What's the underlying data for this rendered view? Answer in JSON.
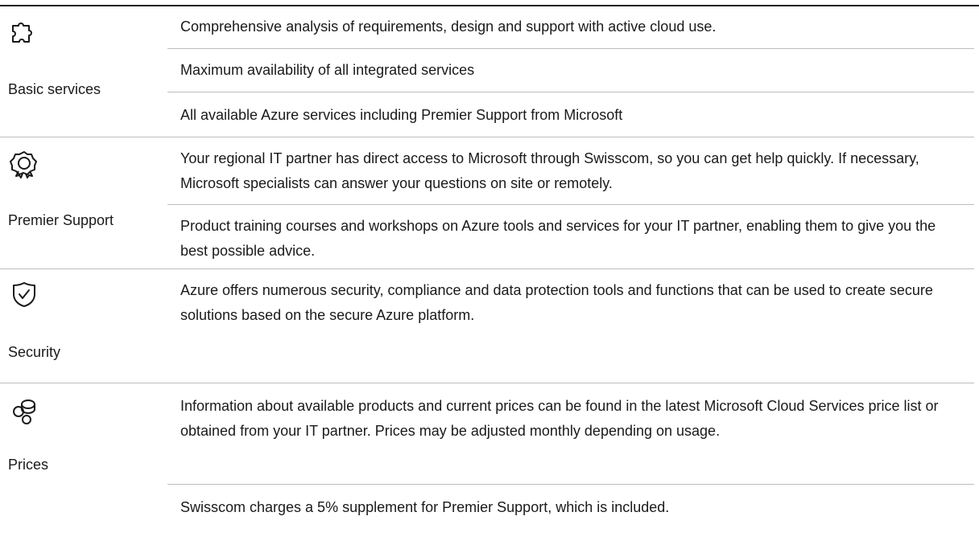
{
  "sections": [
    {
      "label": "Basic services",
      "icon": "puzzle-icon",
      "items": [
        "Comprehensive analysis of requirements, design and support with active cloud use.",
        "Maximum availability of all integrated services",
        "All available Azure services including Premier Support from Microsoft"
      ]
    },
    {
      "label": "Premier Support",
      "icon": "award-badge-icon",
      "items": [
        "Your regional IT partner has direct access to Microsoft through Swisscom, so you can get help quickly. If necessary, Microsoft specialists can answer your questions on site or remotely.",
        "Product training courses and workshops on Azure tools and services for your IT partner, enabling them to give you the best possible advice."
      ]
    },
    {
      "label": "Security",
      "icon": "shield-check-icon",
      "items": [
        "Azure offers numerous security, compliance and data protection tools and functions that can be used to create secure solutions based on the secure Azure platform."
      ]
    },
    {
      "label": "Prices",
      "icon": "coins-icon",
      "items": [
        "Information about available products and current prices can be found in the latest Microsoft Cloud Services price list or obtained from your IT partner. Prices may be adjusted monthly depending on usage.",
        "Swisscom charges a 5% supplement for Premier Support, which is included."
      ]
    }
  ]
}
